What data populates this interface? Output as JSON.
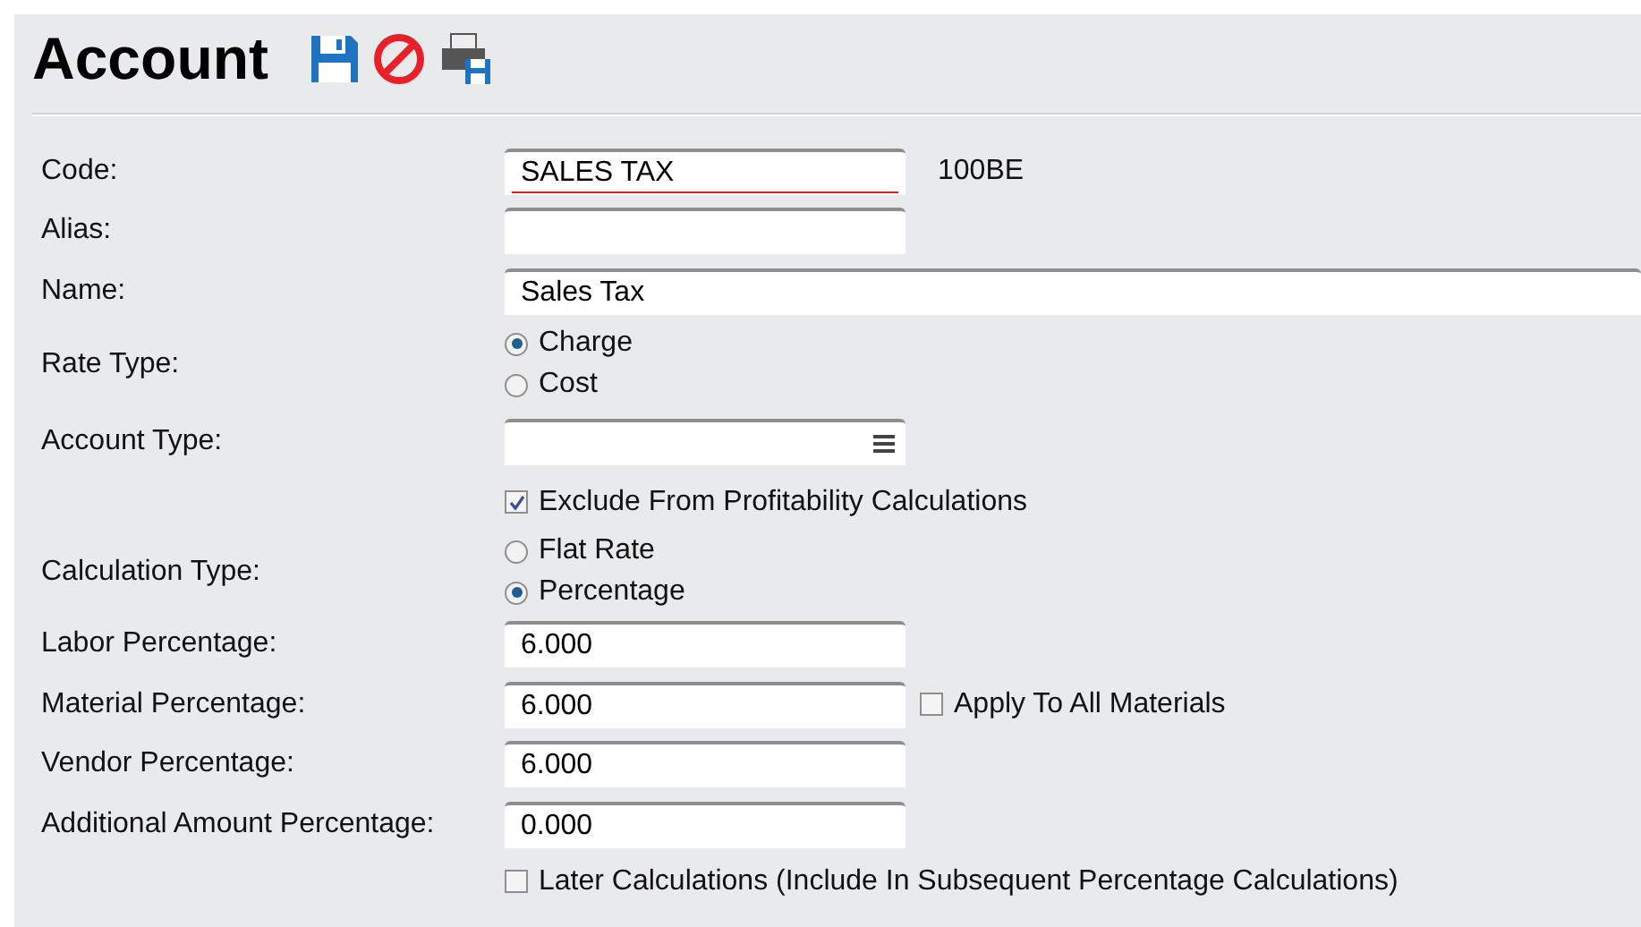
{
  "title": "Account",
  "toolbar": [
    {
      "kind": "save"
    },
    {
      "kind": "cancel"
    },
    {
      "kind": "print"
    }
  ],
  "fields": [
    {
      "kind": "text",
      "label": "Code:",
      "value": "SALES TAX",
      "invalid": true,
      "note": "100BE"
    },
    {
      "kind": "text",
      "label": "Alias:"
    },
    {
      "kind": "wide",
      "label": "Name:",
      "value": "Sales Tax"
    },
    {
      "kind": "radio",
      "label": "Rate Type:",
      "options": [
        {
          "label": "Charge",
          "selected": true
        },
        {
          "label": "Cost",
          "selected": false
        }
      ]
    },
    {
      "kind": "select",
      "label": "Account Type:"
    },
    {
      "kind": "checkbox",
      "label": "Exclude From Profitability Calculations",
      "checked": true
    },
    {
      "kind": "radio",
      "label": "Calculation Type:",
      "options": [
        {
          "label": "Flat Rate",
          "selected": false
        },
        {
          "label": "Percentage",
          "selected": true
        }
      ]
    },
    {
      "kind": "text",
      "label": "Labor Percentage:",
      "value": "6.000"
    },
    {
      "kind": "text",
      "label": "Material Percentage:",
      "value": "6.000",
      "checkbox": {
        "label": "Apply To All Materials",
        "checked": false
      }
    },
    {
      "kind": "text",
      "label": "Vendor Percentage:",
      "value": "6.000"
    },
    {
      "kind": "text",
      "label": "Additional Amount Percentage:",
      "value": "0.000"
    },
    {
      "kind": "checkbox",
      "label": "Later Calculations (Include In Subsequent Percentage Calculations)",
      "checked": false
    }
  ]
}
